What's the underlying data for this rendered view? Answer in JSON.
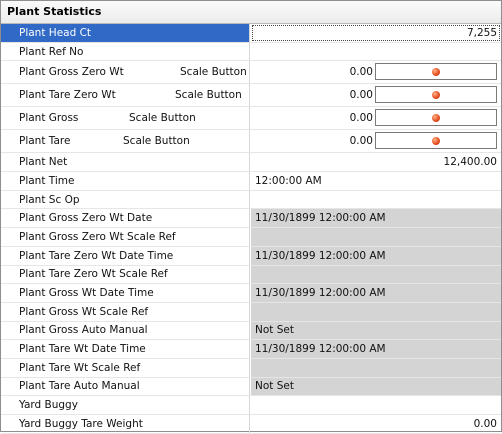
{
  "panel": {
    "title": "Plant Statistics"
  },
  "rows": [
    {
      "label": "Plant Head Ct",
      "value": "7,255",
      "align": "right",
      "bg": "white",
      "selected": true
    },
    {
      "label": "Plant Ref No",
      "value": "",
      "align": "left",
      "bg": "white"
    },
    {
      "label": "Plant Gross Zero Wt",
      "scale_label": "Scale Button",
      "value": "0.00",
      "button": true,
      "bg": "white"
    },
    {
      "label": "Plant Tare Zero Wt",
      "scale_label": "Scale Button",
      "value": "0.00",
      "button": true,
      "bg": "white"
    },
    {
      "label": "Plant Gross",
      "scale_label": "Scale Button",
      "value": "0.00",
      "button": true,
      "bg": "white"
    },
    {
      "label": "Plant Tare",
      "scale_label": "Scale Button",
      "value": "0.00",
      "button": true,
      "bg": "white"
    },
    {
      "label": "Plant Net",
      "value": "12,400.00",
      "align": "right",
      "bg": "white"
    },
    {
      "label": "Plant Time",
      "value": "12:00:00 AM",
      "align": "left",
      "bg": "white"
    },
    {
      "label": "Plant Sc Op",
      "value": "",
      "align": "left",
      "bg": "white"
    },
    {
      "label": "Plant Gross Zero Wt Date",
      "value": "11/30/1899 12:00:00 AM",
      "align": "left",
      "bg": "grey"
    },
    {
      "label": "Plant Gross Zero Wt Scale Ref",
      "value": "",
      "align": "left",
      "bg": "grey"
    },
    {
      "label": "Plant Tare Zero Wt Date Time",
      "value": "11/30/1899 12:00:00 AM",
      "align": "left",
      "bg": "grey"
    },
    {
      "label": "Plant Tare Zero Wt Scale Ref",
      "value": "",
      "align": "left",
      "bg": "grey"
    },
    {
      "label": "Plant Gross Wt Date Time",
      "value": "11/30/1899 12:00:00 AM",
      "align": "left",
      "bg": "grey"
    },
    {
      "label": "Plant Gross Wt Scale Ref",
      "value": "",
      "align": "left",
      "bg": "grey"
    },
    {
      "label": "Plant Gross Auto Manual",
      "value": "Not Set",
      "align": "left",
      "bg": "grey"
    },
    {
      "label": "Plant Tare Wt Date Time",
      "value": "11/30/1899 12:00:00 AM",
      "align": "left",
      "bg": "grey"
    },
    {
      "label": "Plant Tare Wt Scale Ref",
      "value": "",
      "align": "left",
      "bg": "grey"
    },
    {
      "label": "Plant Tare Auto Manual",
      "value": "Not Set",
      "align": "left",
      "bg": "grey"
    },
    {
      "label": "Yard Buggy",
      "value": "",
      "align": "left",
      "bg": "white"
    },
    {
      "label": "Yard Buggy Tare Weight",
      "value": "0.00",
      "align": "right",
      "bg": "white"
    }
  ],
  "colors": {
    "selection": "#3169c6",
    "readonly_cell": "#d4d4d4",
    "button_dot": "#e24a1c"
  },
  "icons": {
    "scale_button": "red-dot-icon"
  }
}
